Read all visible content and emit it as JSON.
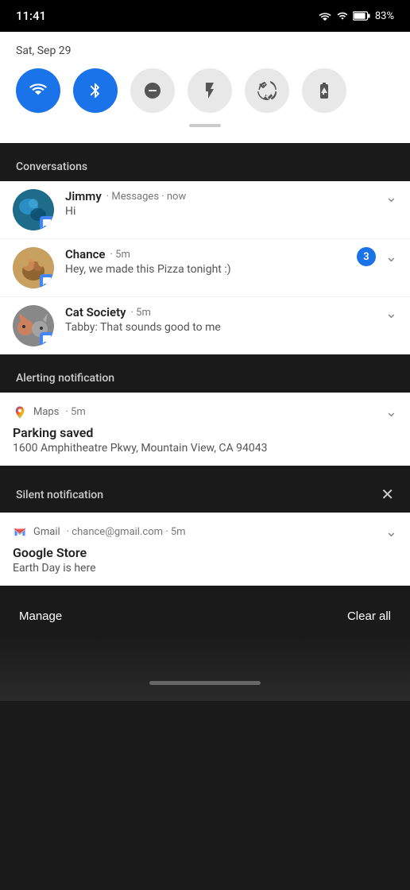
{
  "statusBar": {
    "time": "11:41",
    "battery": "83%"
  },
  "quickSettings": {
    "date": "Sat, Sep 29",
    "toggles": [
      {
        "id": "wifi",
        "label": "Wi-Fi",
        "active": true,
        "icon": "wifi"
      },
      {
        "id": "bluetooth",
        "label": "Bluetooth",
        "active": true,
        "icon": "bluetooth"
      },
      {
        "id": "dnd",
        "label": "Do Not Disturb",
        "active": false,
        "icon": "minus-circle"
      },
      {
        "id": "flashlight",
        "label": "Flashlight",
        "active": false,
        "icon": "flashlight"
      },
      {
        "id": "rotation",
        "label": "Auto Rotate",
        "active": false,
        "icon": "rotation"
      },
      {
        "id": "battery-saver",
        "label": "Battery Saver",
        "active": false,
        "icon": "battery-plus"
      }
    ]
  },
  "sections": {
    "conversations": {
      "label": "Conversations",
      "items": [
        {
          "id": "jimmy",
          "name": "Jimmy",
          "app": "Messages",
          "time": "now",
          "message": "Hi",
          "badgeCount": null,
          "avatarColor": "jimmy"
        },
        {
          "id": "chance",
          "name": "Chance",
          "app": "",
          "time": "5m",
          "message": "Hey, we made this Pizza tonight :)",
          "badgeCount": "3",
          "avatarColor": "chance"
        },
        {
          "id": "cat-society",
          "name": "Cat Society",
          "app": "",
          "time": "5m",
          "message": "Tabby: That sounds good to me",
          "badgeCount": null,
          "avatarColor": "cat"
        }
      ]
    },
    "alerting": {
      "label": "Alerting notification",
      "maps": {
        "app": "Maps",
        "time": "5m",
        "title": "Parking saved",
        "body": "1600 Amphitheatre Pkwy, Mountain View, CA 94043"
      }
    },
    "silent": {
      "label": "Silent notification",
      "gmail": {
        "app": "Gmail",
        "email": "chance@gmail.com",
        "time": "5m",
        "title": "Google Store",
        "body": "Earth Day is here"
      }
    }
  },
  "bottomBar": {
    "manageLabel": "Manage",
    "clearAllLabel": "Clear all"
  }
}
